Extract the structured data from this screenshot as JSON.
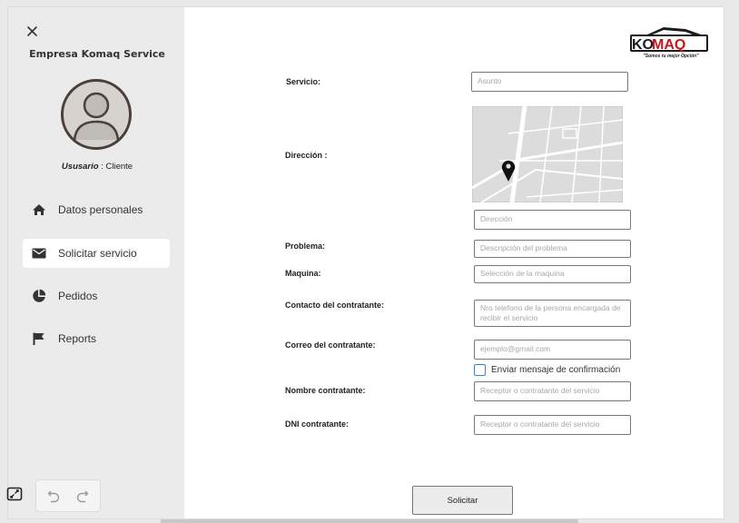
{
  "sidebar": {
    "company_name": "Empresa Komaq Service",
    "user_label": "Ususario",
    "user_role": " : Cliente",
    "nav": [
      {
        "label": "Datos personales",
        "icon": "home-icon"
      },
      {
        "label": "Solicitar servicio",
        "icon": "mail-icon",
        "active": true
      },
      {
        "label": "Pedidos",
        "icon": "pie-chart-icon"
      },
      {
        "label": "Reports",
        "icon": "flag-icon"
      }
    ]
  },
  "logo": {
    "text_ko": "KO",
    "text_maq": "MAQ",
    "slogan": "\"Somos tu mejor Opción\""
  },
  "form": {
    "servicio": {
      "label": "Servicio:",
      "placeholder": "Asunto"
    },
    "direccion": {
      "label": "Dirección :",
      "placeholder": "Dirección"
    },
    "problema": {
      "label": "Problema:",
      "placeholder": "Descripción del problema"
    },
    "maquina": {
      "label": "Maquina:",
      "placeholder": "Selección de la maquina"
    },
    "contacto": {
      "label": "Contacto del contratante:",
      "placeholder": "Nro telefono de la persona encargada de recibir el servicio"
    },
    "correo": {
      "label": "Correo del contratante:",
      "placeholder": "ejemplo@gmail.com"
    },
    "confirmacion": {
      "label": "Enviar mensaje de confirmación",
      "checked": false
    },
    "nombre": {
      "label": "Nombre contratante:",
      "placeholder": "Receptor o contratante del servicio"
    },
    "dni": {
      "label": "DNI contratante:",
      "placeholder": "Receptor o contratante del servicio"
    },
    "submit_label": "Solicitar"
  },
  "colors": {
    "sidebar_bg": "#ebebeb",
    "logo_red": "#c8161d",
    "checkbox_blue": "#3a84c4"
  }
}
